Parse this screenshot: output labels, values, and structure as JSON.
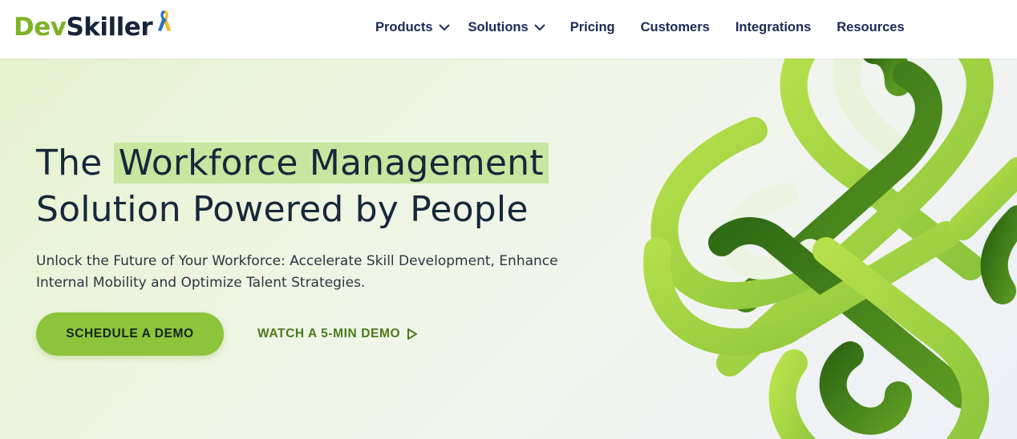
{
  "brand": {
    "logo_part1": "Dev",
    "logo_part2": "Skiller",
    "ribbon_icon": "ukraine-ribbon-icon",
    "colors": {
      "green": "#7fb227",
      "navy": "#16233a",
      "accent": "#8cc43c"
    }
  },
  "nav": {
    "items": [
      {
        "label": "Products",
        "has_dropdown": true
      },
      {
        "label": "Solutions",
        "has_dropdown": true
      },
      {
        "label": "Pricing"
      },
      {
        "label": "Customers"
      },
      {
        "label": "Integrations"
      },
      {
        "label": "Resources"
      }
    ]
  },
  "hero": {
    "title_pre": "The ",
    "title_highlight": "Workforce Management",
    "title_line2": "Solution Powered by People",
    "subtitle_line1": "Unlock the Future of Your Workforce: Accelerate Skill Development, Enhance",
    "subtitle_line2": "Internal Mobility and Optimize Talent Strategies.",
    "primary_cta": "SCHEDULE A DEMO",
    "secondary_cta": "WATCH A 5-MIN DEMO",
    "secondary_cta_icon": "play-outline-icon"
  }
}
